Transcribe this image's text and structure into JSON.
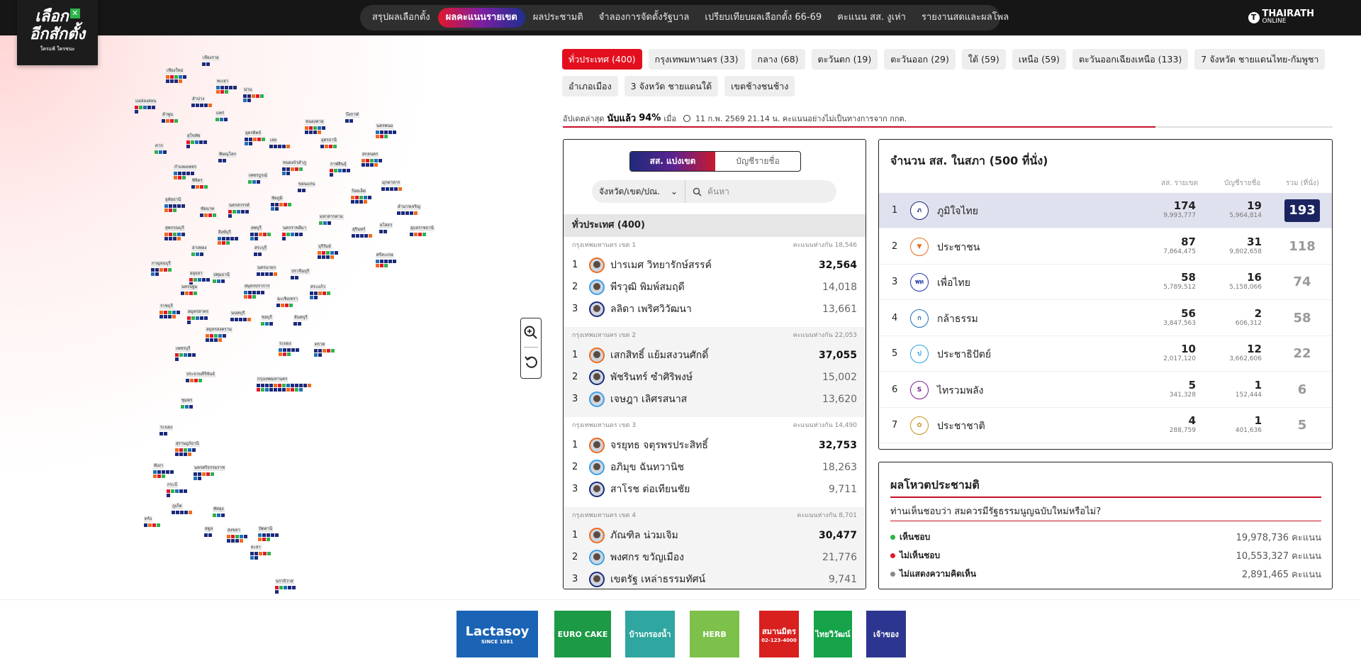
{
  "logo": {
    "line1": "เลือก",
    "line2": "อีกสักตั้ง",
    "tagline": "ใครแพ้ ใครชนะ"
  },
  "nav": {
    "items": [
      "สรุปผลเลือกตั้ง",
      "ผลคะแนนรายเขต",
      "ผลประชามติ",
      "จำลองการจัดตั้งรัฐบาล",
      "เปรียบเทียบผลเลือกตั้ง 66-69",
      "คะแนน สส. งูเห่า",
      "รายงานสดและผลโพล"
    ],
    "active_index": 1
  },
  "brand": {
    "name": "THAIRATH",
    "sub": "ONLINE"
  },
  "map": {
    "provinces": [
      "เชียงราย",
      "เชียงใหม่",
      "พะเยา",
      "น่าน",
      "แม่ฮ่องสอน",
      "ลำปาง",
      "ลำพูน",
      "แพร่",
      "บึงกาฬ",
      "หนองคาย",
      "นครพนม",
      "อุตรดิตถ์",
      "สุโขทัย",
      "เลย",
      "อุดรธานี",
      "ตาก",
      "พิษณุโลก",
      "สกลนคร",
      "กำแพงเพชร",
      "หนองบัวลำภู",
      "กาฬสินธุ์",
      "มุกดาหาร",
      "พิจิตร",
      "เพชรบูรณ์",
      "ขอนแก่น",
      "ร้อยเอ็ด",
      "อุทัยธานี",
      "ชัยภูมิ",
      "นครสวรรค์",
      "อำนาจเจริญ",
      "ชัยนาท",
      "มหาสารคาม",
      "ยโสธร",
      "สุพรรณบุรี",
      "สิงห์บุรี",
      "ลพบุรี",
      "นครราชสีมา",
      "สุรินทร์",
      "อุบลราชธานี",
      "อ่างทอง",
      "สระบุรี",
      "บุรีรัมย์",
      "ศรีสะเกษ",
      "กาญจนบุรี",
      "อยุธยา",
      "นครนายก",
      "นครปฐม",
      "ปทุมธานี",
      "ปราจีนบุรี",
      "ราชบุรี",
      "สมุทรปราการ",
      "สระแก้ว",
      "สมุทรสาคร",
      "นนทบุรี",
      "ฉะเชิงเทรา",
      "ชลบุรี",
      "จันทบุรี",
      "สมุทรสงคราม",
      "ระยอง",
      "ตราด",
      "เพชรบุรี",
      "กรุงเทพมหานคร",
      "ประจวบคีรีขันธ์",
      "ชุมพร",
      "ระนอง",
      "สุราษฎร์ธานี",
      "พังงา",
      "นครศรีธรรมราช",
      "กระบี่",
      "ภูเก็ต",
      "ตรัง",
      "พัทลุง",
      "สตูล",
      "สงขลา",
      "ปัตตานี",
      "ยะลา",
      "นราธิวาส"
    ]
  },
  "filters": {
    "chips": [
      "ทั่วประเทศ (400)",
      "กรุงเทพมหานคร (33)",
      "กลาง (68)",
      "ตะวันตก (19)",
      "ตะวันออก (29)",
      "ใต้ (59)",
      "เหนือ (59)",
      "ตะวันออกเฉียงเหนือ (133)",
      "7 จังหวัด ชายแดนไทย-กัมพูชา",
      "อำเภอเมือง",
      "3 จังหวัด ชายแดนใต้",
      "เขตช้างชนช้าง"
    ],
    "active_index": 0
  },
  "update": {
    "prefix": "อัปเดตล่าสุด",
    "counted_label": "นับแล้ว",
    "percent": "94%",
    "when_label": "เมื่อ",
    "timestamp": "11 ก.พ. 2569 21.14 น. คะแนนอย่างไม่เป็นทางการจาก กกต.",
    "progress": 0.77
  },
  "districts": {
    "tabs": [
      "สส. แบ่งเขต",
      "บัญชีรายชื่อ"
    ],
    "province_select": "จังหวัด/เขต/ปณ.",
    "search_placeholder": "ค้นหา",
    "header": "ทั่วประเทศ (400)",
    "blocks": [
      {
        "title": "กรุงเทพมหานคร เขต 1",
        "margin": "คะแนนห่างกัน 18,546",
        "cands": [
          {
            "rank": "1",
            "name": "ปารเมศ วิทยารักษ์สรรค์",
            "votes": "32,564",
            "p": "p1"
          },
          {
            "rank": "2",
            "name": "พีรวุฒิ พิมพ์สมฤดี",
            "votes": "14,018",
            "p": "p2"
          },
          {
            "rank": "3",
            "name": "ลลิดา เพริศวิวัฒนา",
            "votes": "13,661",
            "p": "p3"
          }
        ]
      },
      {
        "title": "กรุงเทพมหานคร เขต 2",
        "margin": "คะแนนห่างกัน 22,053",
        "cands": [
          {
            "rank": "1",
            "name": "เสกสิทธิ์ แย้มสงวนศักดิ์",
            "votes": "37,055",
            "p": "p1"
          },
          {
            "rank": "2",
            "name": "พัชรินทร์ ซำศิริพงษ์",
            "votes": "15,002",
            "p": "p3"
          },
          {
            "rank": "3",
            "name": "เจษฎา เลิศรสนาส",
            "votes": "13,620",
            "p": "p2"
          }
        ]
      },
      {
        "title": "กรุงเทพมหานคร เขต 3",
        "margin": "คะแนนห่างกัน 14,490",
        "cands": [
          {
            "rank": "1",
            "name": "จรยุทธ จตุรพรประสิทธิ์",
            "votes": "32,753",
            "p": "p1"
          },
          {
            "rank": "2",
            "name": "อภิมุข ฉันทวานิช",
            "votes": "18,263",
            "p": "p2"
          },
          {
            "rank": "3",
            "name": "สาโรช ต่อเทียนชัย",
            "votes": "9,711",
            "p": "p3"
          }
        ]
      },
      {
        "title": "กรุงเทพมหานคร เขต 4",
        "margin": "คะแนนห่างกัน 8,701",
        "cands": [
          {
            "rank": "1",
            "name": "ภัณฑิล น่วมเจิม",
            "votes": "30,477",
            "p": "p1"
          },
          {
            "rank": "2",
            "name": "พงศกร ขวัญเมือง",
            "votes": "21,776",
            "p": "p2"
          },
          {
            "rank": "3",
            "name": "เขตรัฐ เหล่าธรรมทัศน์",
            "votes": "9,741",
            "p": "p3"
          }
        ]
      }
    ]
  },
  "seats": {
    "title": "จำนวน สส. ในสภา (500 ที่นั่ง)",
    "col_district": "สส. รายเขต",
    "col_list": "บัญชีรายชื่อ",
    "col_total": "รวม (ที่นั่ง)",
    "rows": [
      {
        "rank": "1",
        "party": "ภูมิใจไทย",
        "district": "174",
        "district_votes": "9,993,777",
        "list": "19",
        "list_votes": "5,964,814",
        "total": "193",
        "logo_color": "#1b2a7d",
        "logo_text": "ภ"
      },
      {
        "rank": "2",
        "party": "ประชาชน",
        "district": "87",
        "district_votes": "7,864,475",
        "list": "31",
        "list_votes": "9,802,658",
        "total": "118",
        "logo_color": "#f06a1c",
        "logo_text": "▼"
      },
      {
        "rank": "3",
        "party": "เพื่อไทย",
        "district": "58",
        "district_votes": "5,789,512",
        "list": "16",
        "list_votes": "5,158,066",
        "total": "74",
        "logo_color": "#1f3aa8",
        "logo_text": "พท"
      },
      {
        "rank": "4",
        "party": "กล้าธรรม",
        "district": "56",
        "district_votes": "3,847,563",
        "list": "2",
        "list_votes": "606,312",
        "total": "58",
        "logo_color": "#1f6fb8",
        "logo_text": "ก"
      },
      {
        "rank": "5",
        "party": "ประชาธิปัตย์",
        "district": "10",
        "district_votes": "2,017,120",
        "list": "12",
        "list_votes": "3,662,606",
        "total": "22",
        "logo_color": "#2aa3e0",
        "logo_text": "ป"
      },
      {
        "rank": "6",
        "party": "ไทรวมพลัง",
        "district": "5",
        "district_votes": "341,328",
        "list": "1",
        "list_votes": "152,444",
        "total": "6",
        "logo_color": "#7a1f8f",
        "logo_text": "S"
      },
      {
        "rank": "7",
        "party": "ประชาชาติ",
        "district": "4",
        "district_votes": "288,759",
        "list": "1",
        "list_votes": "401,636",
        "total": "5",
        "logo_color": "#c8941f",
        "logo_text": "✿"
      }
    ]
  },
  "referendum": {
    "title": "ผลโหวตประชามติ",
    "question": "ท่านเห็นชอบว่า สมควรมีรัฐธรรมนูญฉบับใหม่หรือไม่?",
    "rows": [
      {
        "label": "เห็นชอบ",
        "value": "19,978,736 คะแนน",
        "color": "#2db34a"
      },
      {
        "label": "ไม่เห็นชอบ",
        "value": "10,553,327 คะแนน",
        "color": "#e3172b"
      },
      {
        "label": "ไม่แสดงความคิดเห็น",
        "value": "2,891,465 คะแนน",
        "color": "#888888"
      }
    ]
  },
  "sponsors": [
    {
      "name": "Lactasoy",
      "sub": "SINCE 1981",
      "color": "#1a63b5"
    },
    {
      "name": "EURO CAKE",
      "sub": "",
      "color": "#1d9a46"
    },
    {
      "name": "บ้านกรองน้ำ",
      "sub": "",
      "color": "#2fa6a0"
    },
    {
      "name": "HERB",
      "sub": "",
      "color": "#7dc04a"
    },
    {
      "name": "สมานมิตร",
      "sub": "02-123-4000",
      "color": "#d8201f"
    },
    {
      "name": "ไทยวิวัฒน์",
      "sub": "",
      "color": "#16a34a"
    },
    {
      "name": "เจ้าของ",
      "sub": "",
      "color": "#2c3690"
    }
  ]
}
